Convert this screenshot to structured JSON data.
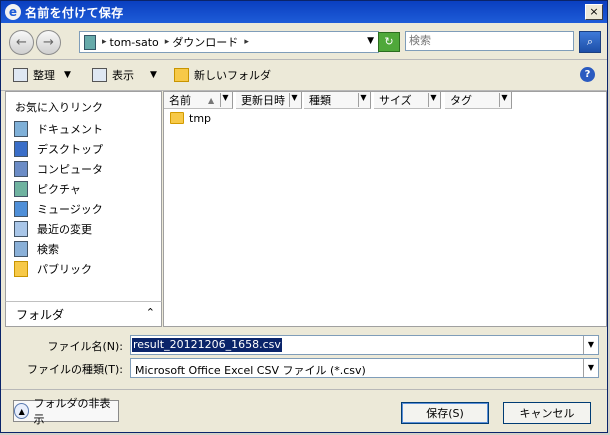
{
  "window": {
    "title": "名前を付けて保存",
    "close_label": "×"
  },
  "addressbar": {
    "path": [
      "tom-sato",
      "ダウンロード"
    ],
    "separator": "▸"
  },
  "search": {
    "placeholder": "検索"
  },
  "toolbar": {
    "organize": "整理",
    "views": "表示",
    "new_folder": "新しいフォルダ",
    "help": "?"
  },
  "navigation": {
    "favorites_title": "お気に入りリンク",
    "items": [
      {
        "label": "ドキュメント",
        "icon": "document-icon"
      },
      {
        "label": "デスクトップ",
        "icon": "desktop-icon"
      },
      {
        "label": "コンピュータ",
        "icon": "computer-icon"
      },
      {
        "label": "ピクチャ",
        "icon": "pictures-icon"
      },
      {
        "label": "ミュージック",
        "icon": "music-icon"
      },
      {
        "label": "最近の変更",
        "icon": "recent-icon"
      },
      {
        "label": "検索",
        "icon": "search-icon"
      },
      {
        "label": "パブリック",
        "icon": "public-folder-icon"
      }
    ],
    "folders_label": "フォルダ",
    "folders_chevron": "⌃"
  },
  "file_list": {
    "columns": [
      "名前",
      "更新日時",
      "種類",
      "サイズ",
      "タグ"
    ],
    "sort_indicator": "▲",
    "rows": [
      {
        "name": "tmp",
        "icon": "folder-icon"
      }
    ]
  },
  "form": {
    "filename_label": "ファイル名(N):",
    "filename_value": "result_20121206_1658.csv",
    "filetype_label": "ファイルの種類(T):",
    "filetype_value": "Microsoft Office Excel CSV ファイル (*.csv)"
  },
  "buttons": {
    "hide_folders": "フォルダの非表示",
    "save": "保存(S)",
    "cancel": "キャンセル"
  },
  "colors": {
    "titlebar": "#1e5cd8",
    "selection": "#0a246a",
    "background": "#ece9d8"
  }
}
